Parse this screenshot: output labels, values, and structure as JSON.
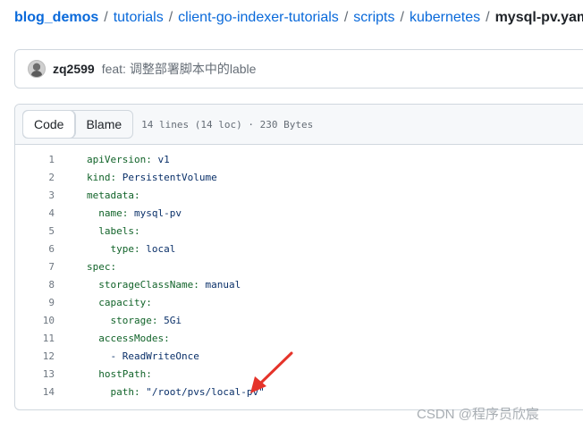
{
  "breadcrumb": {
    "items": [
      "blog_demos",
      "tutorials",
      "client-go-indexer-tutorials",
      "scripts",
      "kubernetes"
    ],
    "separator": "/",
    "current": "mysql-pv.yaml"
  },
  "commit": {
    "author": "zq2599",
    "message": "feat: 调整部署脚本中的lable"
  },
  "file_header": {
    "code_tab": "Code",
    "blame_tab": "Blame",
    "info": "14 lines (14 loc) · 230 Bytes"
  },
  "code_lines": [
    {
      "num": "1",
      "indent": "",
      "key": "apiVersion:",
      "value": " v1"
    },
    {
      "num": "2",
      "indent": "",
      "key": "kind:",
      "value": " PersistentVolume"
    },
    {
      "num": "3",
      "indent": "",
      "key": "metadata:",
      "value": ""
    },
    {
      "num": "4",
      "indent": "  ",
      "key": "name:",
      "value": " mysql-pv"
    },
    {
      "num": "5",
      "indent": "  ",
      "key": "labels:",
      "value": ""
    },
    {
      "num": "6",
      "indent": "    ",
      "key": "type:",
      "value": " local"
    },
    {
      "num": "7",
      "indent": "",
      "key": "spec:",
      "value": ""
    },
    {
      "num": "8",
      "indent": "  ",
      "key": "storageClassName:",
      "value": " manual"
    },
    {
      "num": "9",
      "indent": "  ",
      "key": "capacity:",
      "value": ""
    },
    {
      "num": "10",
      "indent": "    ",
      "key": "storage:",
      "value": " 5Gi"
    },
    {
      "num": "11",
      "indent": "  ",
      "key": "accessModes:",
      "value": ""
    },
    {
      "num": "12",
      "indent": "    ",
      "key": "",
      "value": "- ReadWriteOnce"
    },
    {
      "num": "13",
      "indent": "  ",
      "key": "hostPath:",
      "value": ""
    },
    {
      "num": "14",
      "indent": "    ",
      "key": "path:",
      "value": " \"/root/pvs/local-pv\""
    }
  ],
  "watermark": "CSDN @程序员欣宸",
  "colors": {
    "link": "#0969da",
    "annotation": "#e5332a"
  }
}
